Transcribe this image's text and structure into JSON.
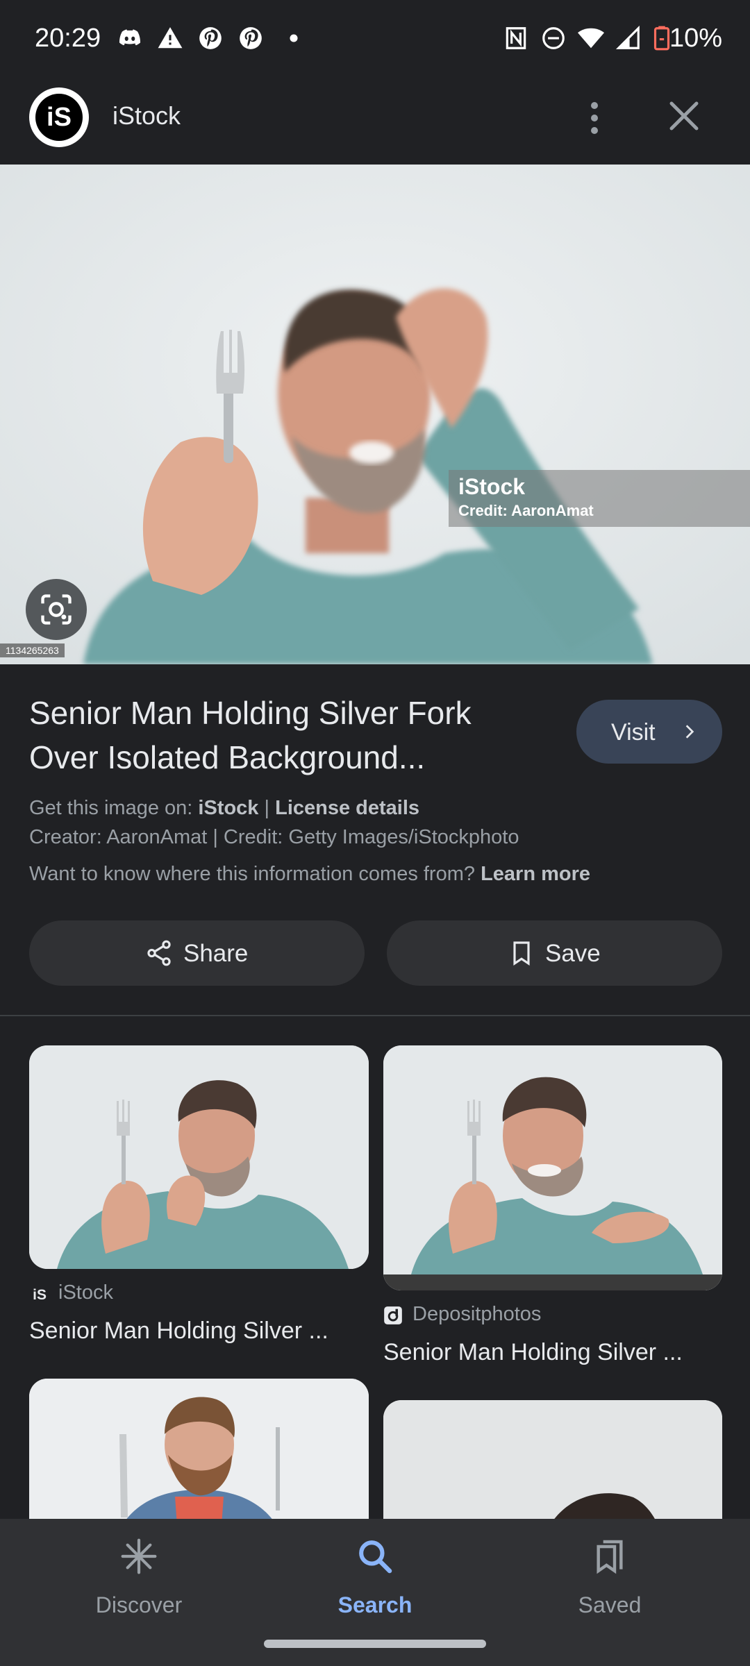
{
  "status_bar": {
    "time": "20:29",
    "battery": "10%"
  },
  "header": {
    "site_name": "iStock",
    "logo_text": "iS"
  },
  "hero": {
    "watermark_brand": "iStock",
    "watermark_credit": "Credit: AaronAmat",
    "image_id": "1134265263"
  },
  "result": {
    "title": "Senior Man Holding Silver Fork Over Isolated Background...",
    "visit_label": "Visit",
    "get_image_prefix": "Get this image on:",
    "get_image_source": "iStock",
    "separator": "|",
    "license_details": "License details",
    "creator_line": "Creator: AaronAmat | Credit: Getty Images/iStockphoto",
    "info_question": "Want to know where this information comes from?",
    "learn_more": "Learn more",
    "share_label": "Share",
    "save_label": "Save"
  },
  "related": [
    {
      "source": "iStock",
      "title": "Senior Man Holding Silver ..."
    },
    {
      "source": "Depositphotos",
      "title": "Senior Man Holding Silver ..."
    }
  ],
  "bottom_nav": {
    "items": [
      {
        "label": "Discover",
        "icon": "asterisk-icon"
      },
      {
        "label": "Search",
        "icon": "search-icon"
      },
      {
        "label": "Saved",
        "icon": "bookmarks-icon"
      }
    ],
    "active": "Search",
    "active_color": "#8ab4f8"
  }
}
